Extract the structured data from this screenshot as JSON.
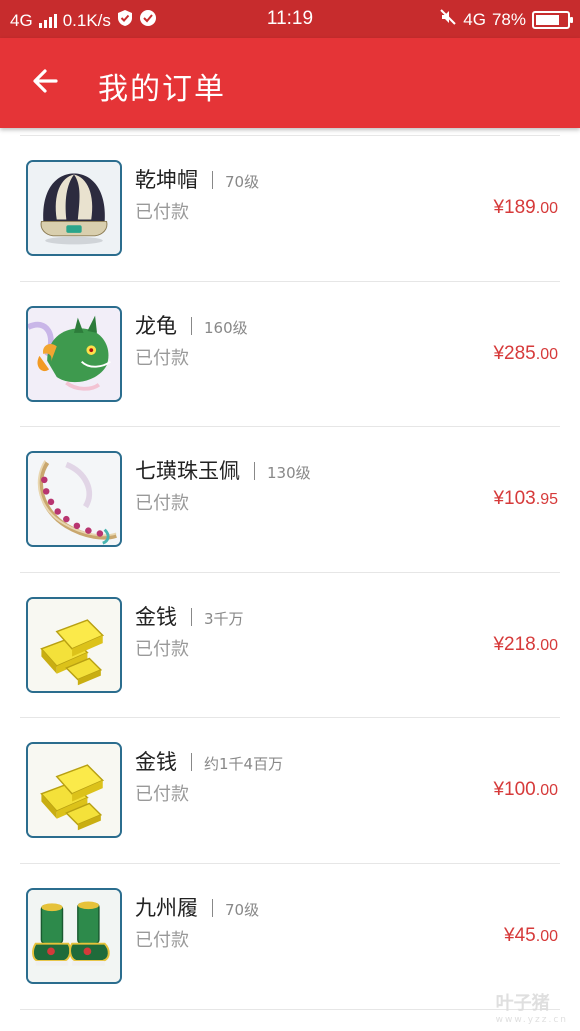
{
  "status_bar": {
    "network": "4G",
    "speed": "0.1K/s",
    "time": "11:19",
    "network_right": "4G",
    "battery": "78%",
    "battery_level": 0.78
  },
  "header": {
    "title": "我的订单"
  },
  "orders": [
    {
      "name": "乾坤帽",
      "level": "70级",
      "status": "已付款",
      "price_int": "¥189",
      "price_dec": ".00",
      "icon": "hat-icon"
    },
    {
      "name": "龙龟",
      "level": "160级",
      "status": "已付款",
      "price_int": "¥285",
      "price_dec": ".00",
      "icon": "dragon-turtle-icon"
    },
    {
      "name": "七璜珠玉佩",
      "level": "130级",
      "status": "已付款",
      "price_int": "¥103",
      "price_dec": ".95",
      "icon": "jade-pendant-icon"
    },
    {
      "name": "金钱",
      "level": "3千万",
      "status": "已付款",
      "price_int": "¥218",
      "price_dec": ".00",
      "icon": "gold-bars-icon"
    },
    {
      "name": "金钱",
      "level": "约1千4百万",
      "status": "已付款",
      "price_int": "¥100",
      "price_dec": ".00",
      "icon": "gold-bars-icon"
    },
    {
      "name": "九州履",
      "level": "70级",
      "status": "已付款",
      "price_int": "¥45",
      "price_dec": ".00",
      "icon": "boots-icon"
    }
  ],
  "watermark": {
    "text": "叶子猪",
    "sub": "www.yzz.cn"
  },
  "colors": {
    "status_bar": "#c72c2d",
    "app_bar": "#e53437",
    "price": "#d63a3a"
  }
}
